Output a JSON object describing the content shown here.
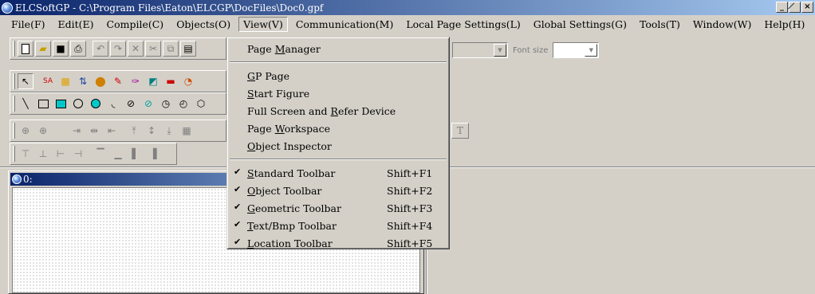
{
  "window": {
    "title": "ELCSoftGP - C:\\Program Files\\Eaton\\ELCGP\\DocFiles\\Doc0.gpf",
    "buttons": [
      "_",
      "̸",
      "×"
    ]
  },
  "menubar": [
    {
      "label": "File(F)",
      "active": false
    },
    {
      "label": "Edit(E)",
      "active": false
    },
    {
      "label": "Compile(C)",
      "active": false
    },
    {
      "label": "Objects(O)",
      "active": false
    },
    {
      "label": "View(V)",
      "active": true
    },
    {
      "label": "Communication(M)",
      "active": false
    },
    {
      "label": "Local Page Settings(L)",
      "active": false
    },
    {
      "label": "Global Settings(G)",
      "active": false
    },
    {
      "label": "Tools(T)",
      "active": false
    },
    {
      "label": "Window(W)",
      "active": false
    },
    {
      "label": "Help(H)",
      "active": false
    }
  ],
  "text_toolbar": {
    "font_size_label": "Font size",
    "text_button": "T"
  },
  "view_menu": {
    "group1": [
      {
        "pre": "Page ",
        "key": "M",
        "post": "anager"
      }
    ],
    "group2": [
      {
        "pre": "",
        "key": "G",
        "post": "P Page"
      },
      {
        "pre": "",
        "key": "S",
        "post": "tart Figure"
      },
      {
        "pre": "Full Screen and ",
        "key": "R",
        "post": "efer Device"
      },
      {
        "pre": "Page ",
        "key": "W",
        "post": "orkspace"
      },
      {
        "pre": "",
        "key": "O",
        "post": "bject Inspector"
      }
    ],
    "group3": [
      {
        "pre": "",
        "key": "S",
        "post": "tandard Toolbar",
        "shortcut": "Shift+F1",
        "checked": true
      },
      {
        "pre": "",
        "key": "O",
        "post": "bject Toolbar",
        "shortcut": "Shift+F2",
        "checked": true
      },
      {
        "pre": "",
        "key": "G",
        "post": "eometric Toolbar",
        "shortcut": "Shift+F3",
        "checked": true
      },
      {
        "pre": "",
        "key": "T",
        "post": "ext/Bmp Toolbar",
        "shortcut": "Shift+F4",
        "checked": true
      },
      {
        "pre": "",
        "key": "L",
        "post": "ocation Toolbar",
        "shortcut": "Shift+F5",
        "checked": true
      }
    ]
  },
  "document": {
    "title": "0:"
  },
  "icons": {
    "standard": [
      "new-file-icon",
      "open-folder-icon",
      "save-icon",
      "print-icon",
      "undo-icon",
      "redo-icon",
      "delete-icon",
      "cut-icon",
      "copy-icon",
      "paste-icon"
    ],
    "object": [
      "pointer-icon",
      "sa-icon",
      "button-icon",
      "meter-icon",
      "lamp-icon",
      "tool-icon",
      "chart-icon",
      "picture-icon",
      "bar-icon",
      "gauge-icon"
    ],
    "geometric": [
      "line-icon",
      "rectangle-icon",
      "filled-rectangle-icon",
      "circle-icon",
      "filled-circle-icon",
      "arc-icon",
      "ellipse-icon",
      "pie-icon",
      "clock-icon",
      "chord-icon",
      "polygon-icon"
    ],
    "location1": [
      "zoom-in-icon",
      "zoom-out-icon",
      "align-left-icon",
      "align-center-icon",
      "align-right-icon",
      "align-top-icon",
      "align-middle-icon",
      "align-bottom-icon",
      "grid-icon"
    ],
    "location2": [
      "size-top-icon",
      "size-bottom-icon",
      "size-left-icon",
      "size-right-icon",
      "same-width-icon",
      "same-height-icon",
      "same-size-icon",
      "distribute-icon"
    ]
  },
  "colors": {
    "titlebar_start": "#0a246a",
    "titlebar_end": "#a6caf0",
    "face": "#d4d0c8"
  }
}
